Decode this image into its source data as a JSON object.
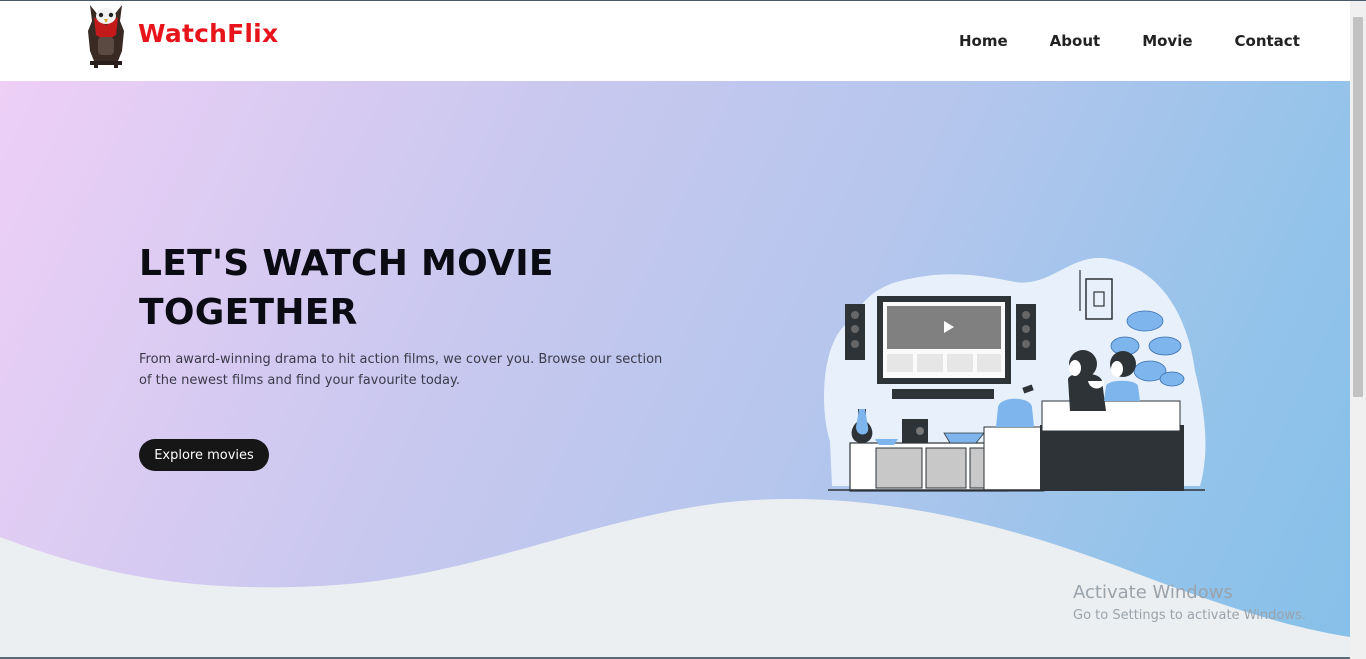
{
  "brand": {
    "name": "WatchFlix",
    "accent_color": "#e8141c",
    "logo_icon": "owl-logo"
  },
  "nav": {
    "items": [
      {
        "label": "Home"
      },
      {
        "label": "About"
      },
      {
        "label": "Movie"
      },
      {
        "label": "Contact"
      }
    ]
  },
  "hero": {
    "title": "LET'S WATCH MOVIE TOGETHER",
    "description": "From award-winning drama to hit action films, we cover you. Browse our section of the newest films and find your favourite today.",
    "cta_label": "Explore movies",
    "illustration_icon": "couple-watching-tv-illustration",
    "gradient_colors": [
      "#eecff6",
      "#b5c6ed",
      "#86c0e9"
    ]
  },
  "watermark": {
    "title": "Activate Windows",
    "subtitle": "Go to Settings to activate Windows."
  }
}
